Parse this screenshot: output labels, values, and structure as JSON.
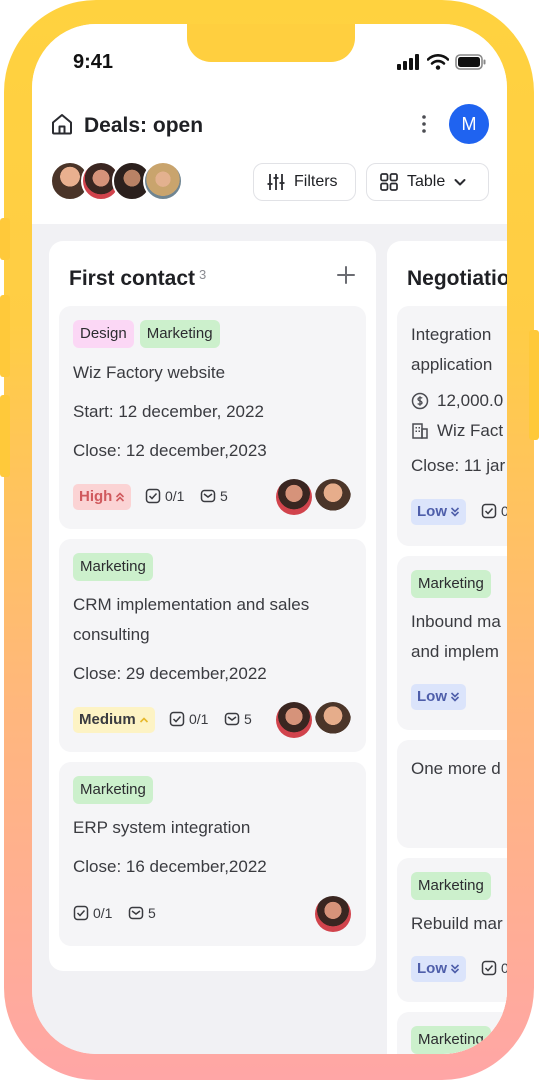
{
  "status_bar": {
    "time": "9:41"
  },
  "header": {
    "title": "Deals: open",
    "user_initial": "M",
    "filters_label": "Filters",
    "view_label": "Table"
  },
  "columns": [
    {
      "title": "First contact",
      "count": "3",
      "cards": [
        {
          "tags": [
            "Design",
            "Marketing"
          ],
          "name": "Wiz Factory website",
          "start": "Start: 12 december, 2022",
          "close": "Close: 12 december,2023",
          "priority": "High",
          "tasks": "0/1",
          "messages": "5"
        },
        {
          "tags": [
            "Marketing"
          ],
          "name_line1": "CRM implementation and sales",
          "name_line2": "consulting",
          "close": "Close: 29 december,2022",
          "priority": "Medium",
          "tasks": "0/1",
          "messages": "5"
        },
        {
          "tags": [
            "Marketing"
          ],
          "name": "ERP system integration",
          "close": "Close: 16 december,2022",
          "tasks": "0/1",
          "messages": "5"
        }
      ]
    },
    {
      "title": "Negotiatio",
      "cards": [
        {
          "name_line1": "Integration",
          "name_line2": "application",
          "amount": "12,000.0",
          "company": "Wiz Fact",
          "close": "Close: 11 jar",
          "priority": "Low",
          "tasks": "0"
        },
        {
          "tags": [
            "Marketing"
          ],
          "name_line1": "Inbound ma",
          "name_line2": "and implem",
          "priority": "Low"
        },
        {
          "name": "One more d"
        },
        {
          "tags": [
            "Marketing"
          ],
          "name": "Rebuild mar",
          "priority": "Low",
          "tasks": "0"
        },
        {
          "tags": [
            "Marketing"
          ]
        }
      ]
    }
  ],
  "colors": {
    "accent": "#1f63f0",
    "frame_top": "#ffd23f",
    "frame_bottom": "#ffa6a6",
    "tag_design": "#fbd7f5",
    "tag_marketing": "#ccf0cc",
    "priority_high": "#fbd3d4",
    "priority_medium": "#fdf3c4",
    "priority_low": "#dbe4fb"
  }
}
